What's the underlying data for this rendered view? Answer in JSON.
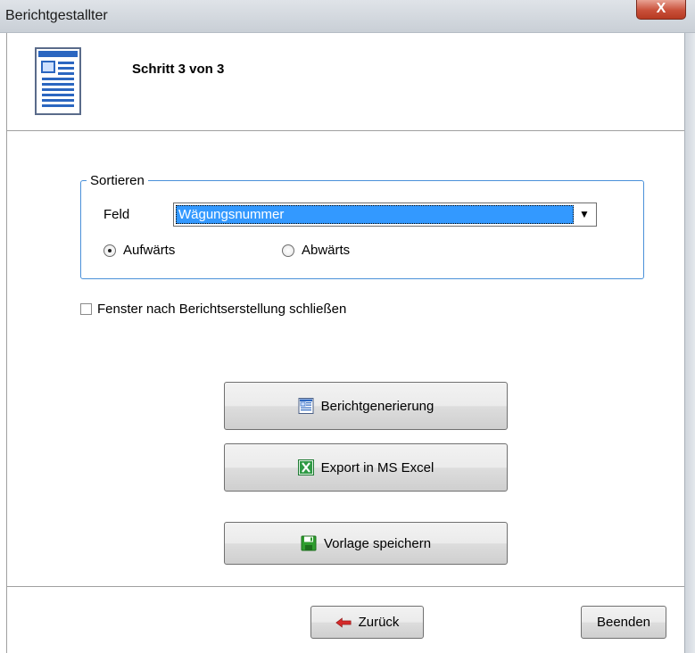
{
  "window": {
    "title": "Berichtgestallter",
    "close_label": "X"
  },
  "header": {
    "step_title": "Schritt 3 von 3"
  },
  "sort": {
    "group_label": "Sortieren",
    "field_label": "Feld",
    "field_value": "Wägungsnummer",
    "ascending_label": "Aufwärts",
    "descending_label": "Abwärts",
    "selected": "ascending"
  },
  "options": {
    "close_after_label": "Fenster nach Berichtserstellung schließen",
    "close_after_checked": false
  },
  "actions": {
    "generate_label": "Berichtgenerierung",
    "export_label": "Export in MS Excel",
    "save_template_label": "Vorlage speichern"
  },
  "footer": {
    "back_label": "Zurück",
    "finish_label": "Beenden"
  },
  "icons": {
    "report": "report-icon",
    "excel": "excel-icon",
    "save": "floppy-disk-icon",
    "back": "arrow-left-icon"
  },
  "colors": {
    "selection": "#3399ff",
    "group_border": "#4a90d9",
    "close_button": "#c9503a",
    "back_arrow": "#d42a2a",
    "save_icon": "#2e9e2e",
    "excel_icon": "#1e7a32"
  }
}
